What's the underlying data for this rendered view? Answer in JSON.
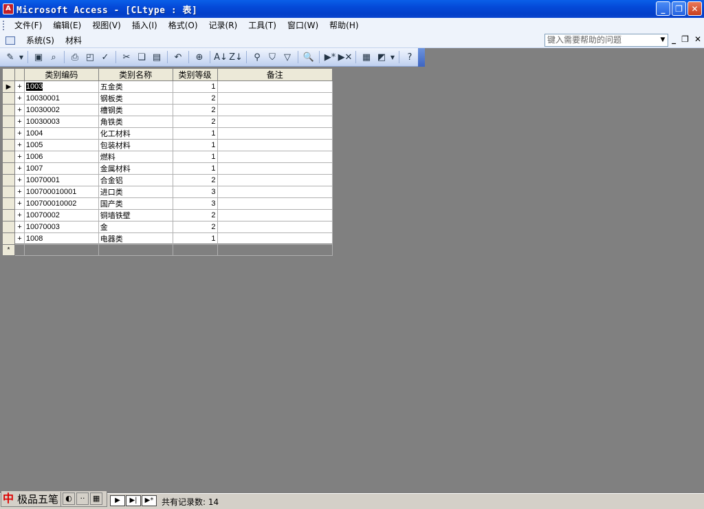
{
  "window": {
    "title": "Microsoft Access - [CLtype : 表]",
    "controls": [
      "minimize",
      "restore",
      "close"
    ]
  },
  "menu": {
    "items": [
      "文件(F)",
      "编辑(E)",
      "视图(V)",
      "插入(I)",
      "格式(O)",
      "记录(R)",
      "工具(T)",
      "窗口(W)",
      "帮助(H)"
    ],
    "custom": [
      "系统(S)",
      "材料"
    ]
  },
  "help_search": {
    "placeholder": "键入需要帮助的问题"
  },
  "toolbar": {
    "icons": [
      "design-view-icon",
      "save-icon",
      "file-search-icon",
      "print-icon",
      "print-preview-icon",
      "spelling-icon",
      "cut-icon",
      "copy-icon",
      "paste-icon",
      "undo-icon",
      "hyperlink-icon",
      "sort-asc-icon",
      "sort-desc-icon",
      "filter-selection-icon",
      "filter-form-icon",
      "apply-filter-icon",
      "find-icon",
      "new-record-icon",
      "delete-record-icon",
      "properties-icon",
      "new-object-icon",
      "help-icon"
    ]
  },
  "datasheet": {
    "columns": [
      "类别编码",
      "类别名称",
      "类别等级",
      "备注"
    ],
    "rows": [
      {
        "code": "1003",
        "name": "五金类",
        "level": "1",
        "note": ""
      },
      {
        "code": "10030001",
        "name": "钢板类",
        "level": "2",
        "note": ""
      },
      {
        "code": "10030002",
        "name": "槽钢类",
        "level": "2",
        "note": ""
      },
      {
        "code": "10030003",
        "name": "角铁类",
        "level": "2",
        "note": ""
      },
      {
        "code": "1004",
        "name": "化工材料",
        "level": "1",
        "note": ""
      },
      {
        "code": "1005",
        "name": "包装材料",
        "level": "1",
        "note": ""
      },
      {
        "code": "1006",
        "name": "燃料",
        "level": "1",
        "note": ""
      },
      {
        "code": "1007",
        "name": "金属材料",
        "level": "1",
        "note": ""
      },
      {
        "code": "10070001",
        "name": "合金铝",
        "level": "2",
        "note": ""
      },
      {
        "code": "100700010001",
        "name": "进口类",
        "level": "3",
        "note": ""
      },
      {
        "code": "100700010002",
        "name": "国产类",
        "level": "3",
        "note": ""
      },
      {
        "code": "10070002",
        "name": "铜墙铁壁",
        "level": "2",
        "note": ""
      },
      {
        "code": "10070003",
        "name": "金",
        "level": "2",
        "note": ""
      },
      {
        "code": "1008",
        "name": "电器类",
        "level": "1",
        "note": ""
      }
    ],
    "expand_symbol": "+",
    "current_row_marker": "▶",
    "new_row_marker": "*"
  },
  "statusbar": {
    "ime_name": "极品五笔",
    "ime_logo": "中",
    "record_count_text": "共有记录数: 14",
    "nav": [
      "▶",
      "▶|",
      "▶*"
    ]
  }
}
